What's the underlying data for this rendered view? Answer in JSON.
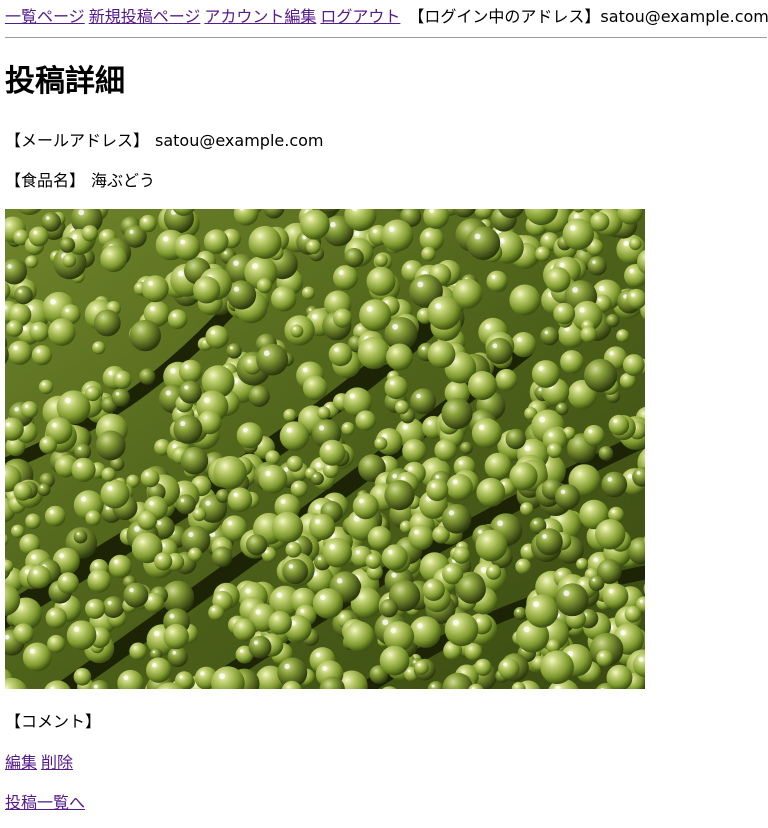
{
  "nav": {
    "list_label": "一覧ページ",
    "new_post_label": "新規投稿ページ",
    "account_edit_label": "アカウント編集",
    "logout_label": "ログアウト",
    "login_prefix": "【ログイン中のアドレス】",
    "login_email": "satou@example.com"
  },
  "page": {
    "title": "投稿詳細"
  },
  "post": {
    "email_label": "【メールアドレス】",
    "email_value": "satou@example.com",
    "food_label": "【食品名】",
    "food_value": "海ぶどう",
    "image_alt": "海ぶどう",
    "comment_label": "【コメント】",
    "comment_value": ""
  },
  "actions": {
    "edit_label": "編集",
    "delete_label": "削除",
    "back_label": "投稿一覧へ"
  },
  "colors": {
    "link": "#551a8b",
    "text": "#000000",
    "divider": "#9a9a9a"
  }
}
